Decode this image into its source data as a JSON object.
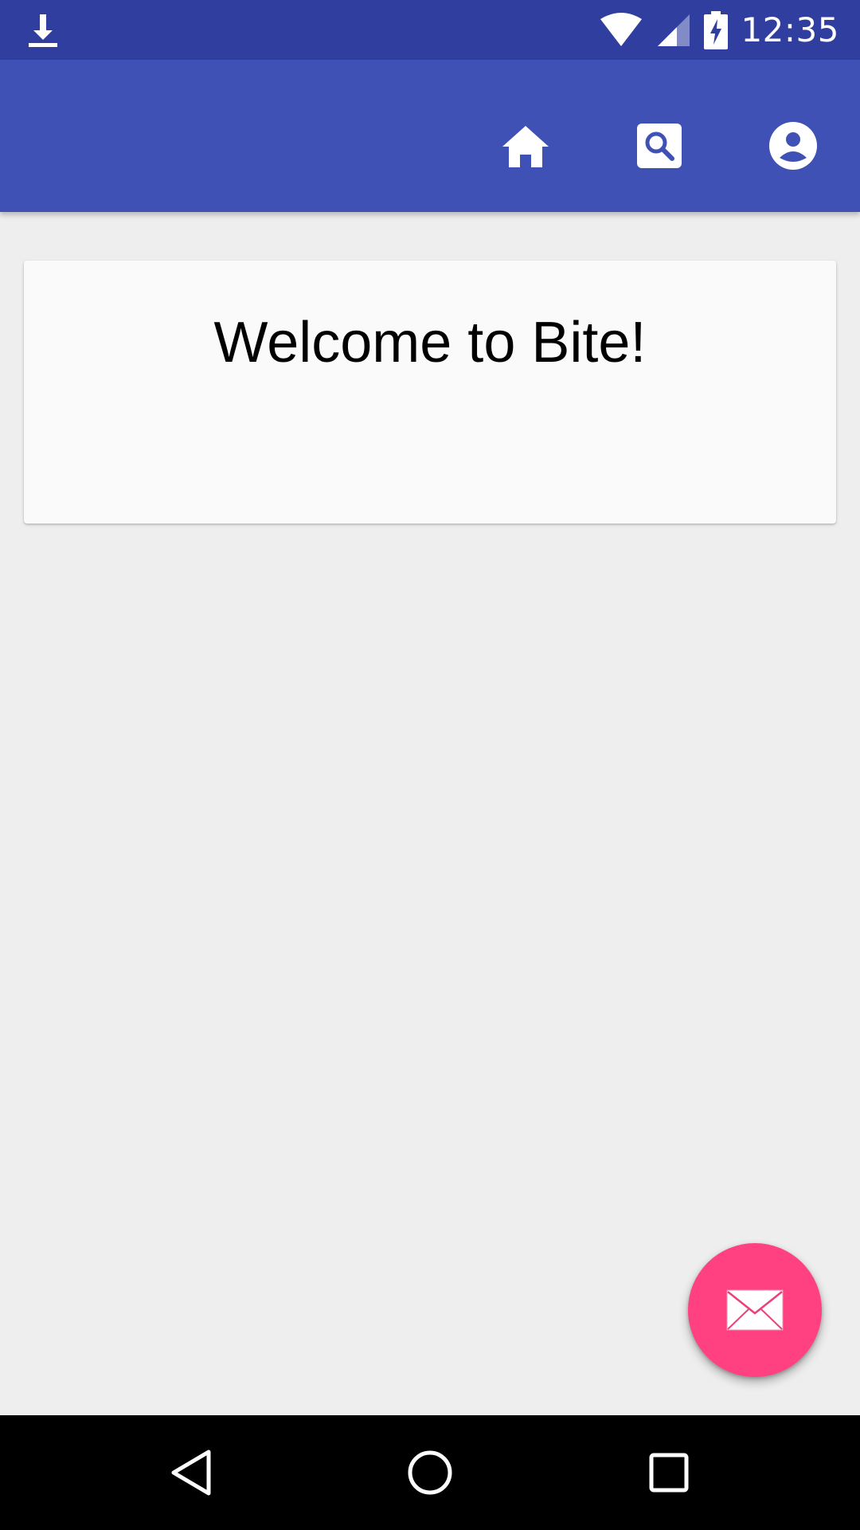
{
  "status_bar": {
    "time": "12:35",
    "icons": [
      "download-icon",
      "wifi-icon",
      "signal-icon",
      "battery-charging-icon"
    ]
  },
  "app_bar": {
    "actions": [
      {
        "name": "home",
        "icon": "home-icon"
      },
      {
        "name": "search",
        "icon": "search-icon"
      },
      {
        "name": "profile",
        "icon": "account-circle-icon"
      }
    ],
    "colors": {
      "primary": "#3f51b5",
      "primary_dark": "#303f9f"
    }
  },
  "card": {
    "title": "Welcome to Bite!"
  },
  "fab": {
    "icon": "mail-icon",
    "color": "#ff4081"
  },
  "nav_bar": {
    "buttons": [
      "back-icon",
      "home-circle-icon",
      "recents-icon"
    ]
  }
}
